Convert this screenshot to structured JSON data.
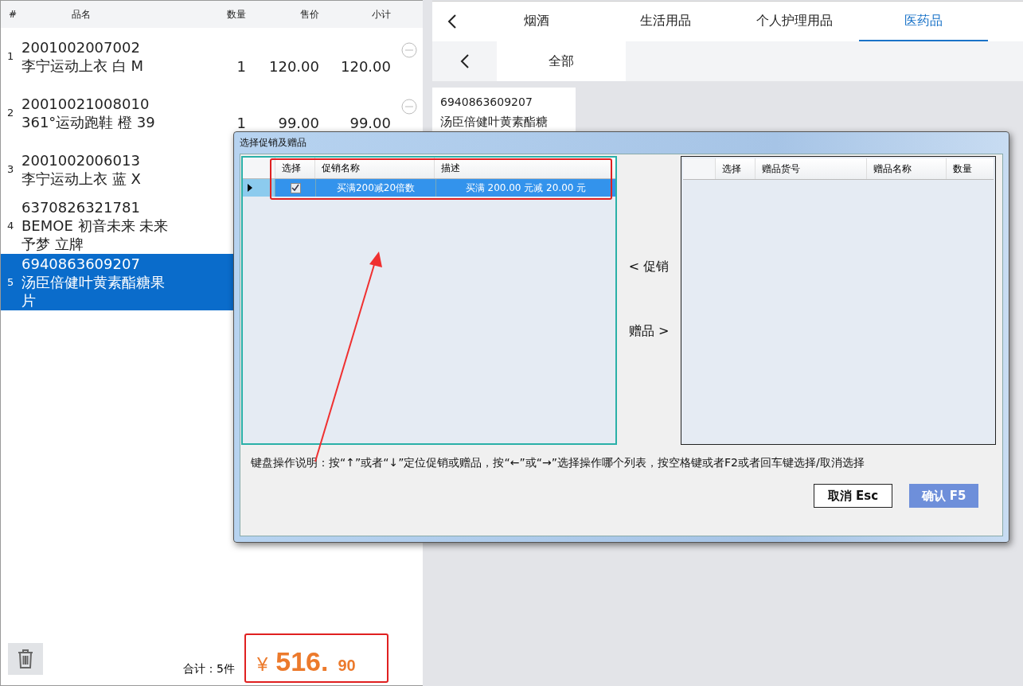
{
  "cart": {
    "columns": [
      "#",
      "品名",
      "数量",
      "售价",
      "小计"
    ],
    "rows": [
      {
        "index": "1",
        "code": "2001002007002",
        "name": "李宁运动上衣 白 M",
        "qty": "1",
        "price": "120.00",
        "subtotal": "120.00",
        "removable": true,
        "selected": false
      },
      {
        "index": "2",
        "code": "20010021008010",
        "name": "361°运动跑鞋 橙 39",
        "qty": "1",
        "price": "99.00",
        "subtotal": "99.00",
        "removable": true,
        "selected": false
      },
      {
        "index": "3",
        "code": "2001002006013",
        "name": "李宁运动上衣 蓝 X",
        "selected": false
      },
      {
        "index": "4",
        "code": "6370826321781",
        "name": "BEMOE 初音未来 未来予梦 立牌",
        "selected": false
      },
      {
        "index": "5",
        "code": "6940863609207",
        "name": "汤臣倍健叶黄素酯糖果片",
        "selected": true
      }
    ],
    "total_label": "合计：5件",
    "total_symbol": "¥",
    "total_integer": "516.",
    "total_decimal": "90"
  },
  "categories": {
    "tabs": [
      {
        "label": "烟酒",
        "selected": false
      },
      {
        "label": "生活用品",
        "selected": false
      },
      {
        "label": "个人护理用品",
        "selected": false
      },
      {
        "label": "医药品",
        "selected": true
      }
    ],
    "subtabs": [
      {
        "label": "全部",
        "selected": true
      }
    ],
    "products": [
      {
        "code": "6940863609207",
        "name": "汤臣倍健叶黄素酯糖"
      }
    ]
  },
  "dialog": {
    "title": "选择促销及赠品",
    "promotions": {
      "columns": [
        "选择",
        "促销名称",
        "描述"
      ],
      "rows": [
        {
          "checked": true,
          "selected": true,
          "name": "买满200减20倍数",
          "description": "买满 200.00 元减 20.00 元"
        }
      ]
    },
    "to_promotions": "< 促销",
    "to_gifts": "赠品 >",
    "gifts": {
      "columns": [
        "选择",
        "赠品货号",
        "赠品名称",
        "数量"
      ]
    },
    "help": "键盘操作说明：按“↑”或者“↓”定位促销或赠品，按“←”或“→”选择操作哪个列表，按空格键或者F2或者回车键选择/取消选择",
    "buttons": [
      {
        "label": "取消 Esc",
        "kind": "secondary"
      },
      {
        "label": "确认 F5",
        "kind": "primary"
      }
    ]
  }
}
